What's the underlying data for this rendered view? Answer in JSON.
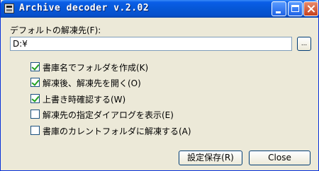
{
  "window": {
    "title": "Archive decoder v.2.02"
  },
  "destination": {
    "label": "デフォルトの解凍先(F):",
    "value": "D:¥",
    "browse_label": "..."
  },
  "options": [
    {
      "label": "書庫名でフォルダを作成(K)",
      "checked": true
    },
    {
      "label": "解凍後、解凍先を開く(O)",
      "checked": true
    },
    {
      "label": "上書き時確認する(W)",
      "checked": true
    },
    {
      "label": "解凍先の指定ダイアログを表示(E)",
      "checked": false
    },
    {
      "label": "書庫のカレントフォルダに解凍する(A)",
      "checked": false
    }
  ],
  "buttons": {
    "save": "設定保存(R)",
    "close": "Close"
  }
}
